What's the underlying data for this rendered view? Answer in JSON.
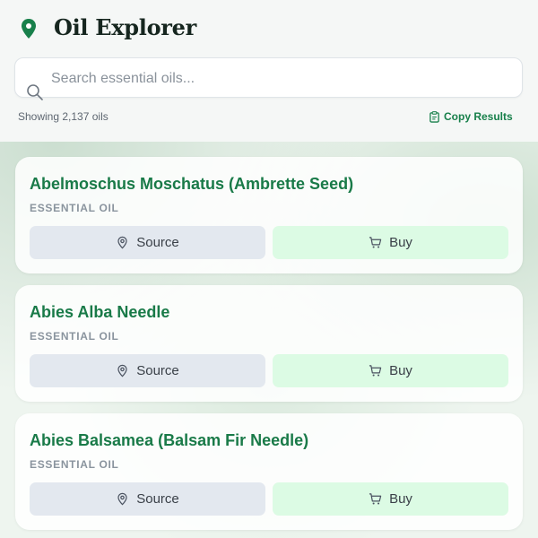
{
  "app": {
    "title": "Oil Explorer",
    "logo_icon": "map-pin-icon",
    "accent_color": "#18804b"
  },
  "search": {
    "placeholder": "Search essential oils...",
    "value": ""
  },
  "summary": {
    "count_text": "Showing 2,137 oils",
    "copy_label": "Copy Results"
  },
  "results": [
    {
      "name": "Abelmoschus Moschatus (Ambrette Seed)",
      "type": "ESSENTIAL OIL",
      "source_label": "Source",
      "buy_label": "Buy"
    },
    {
      "name": "Abies Alba Needle",
      "type": "ESSENTIAL OIL",
      "source_label": "Source",
      "buy_label": "Buy"
    },
    {
      "name": "Abies Balsamea (Balsam Fir Needle)",
      "type": "ESSENTIAL OIL",
      "source_label": "Source",
      "buy_label": "Buy"
    }
  ]
}
